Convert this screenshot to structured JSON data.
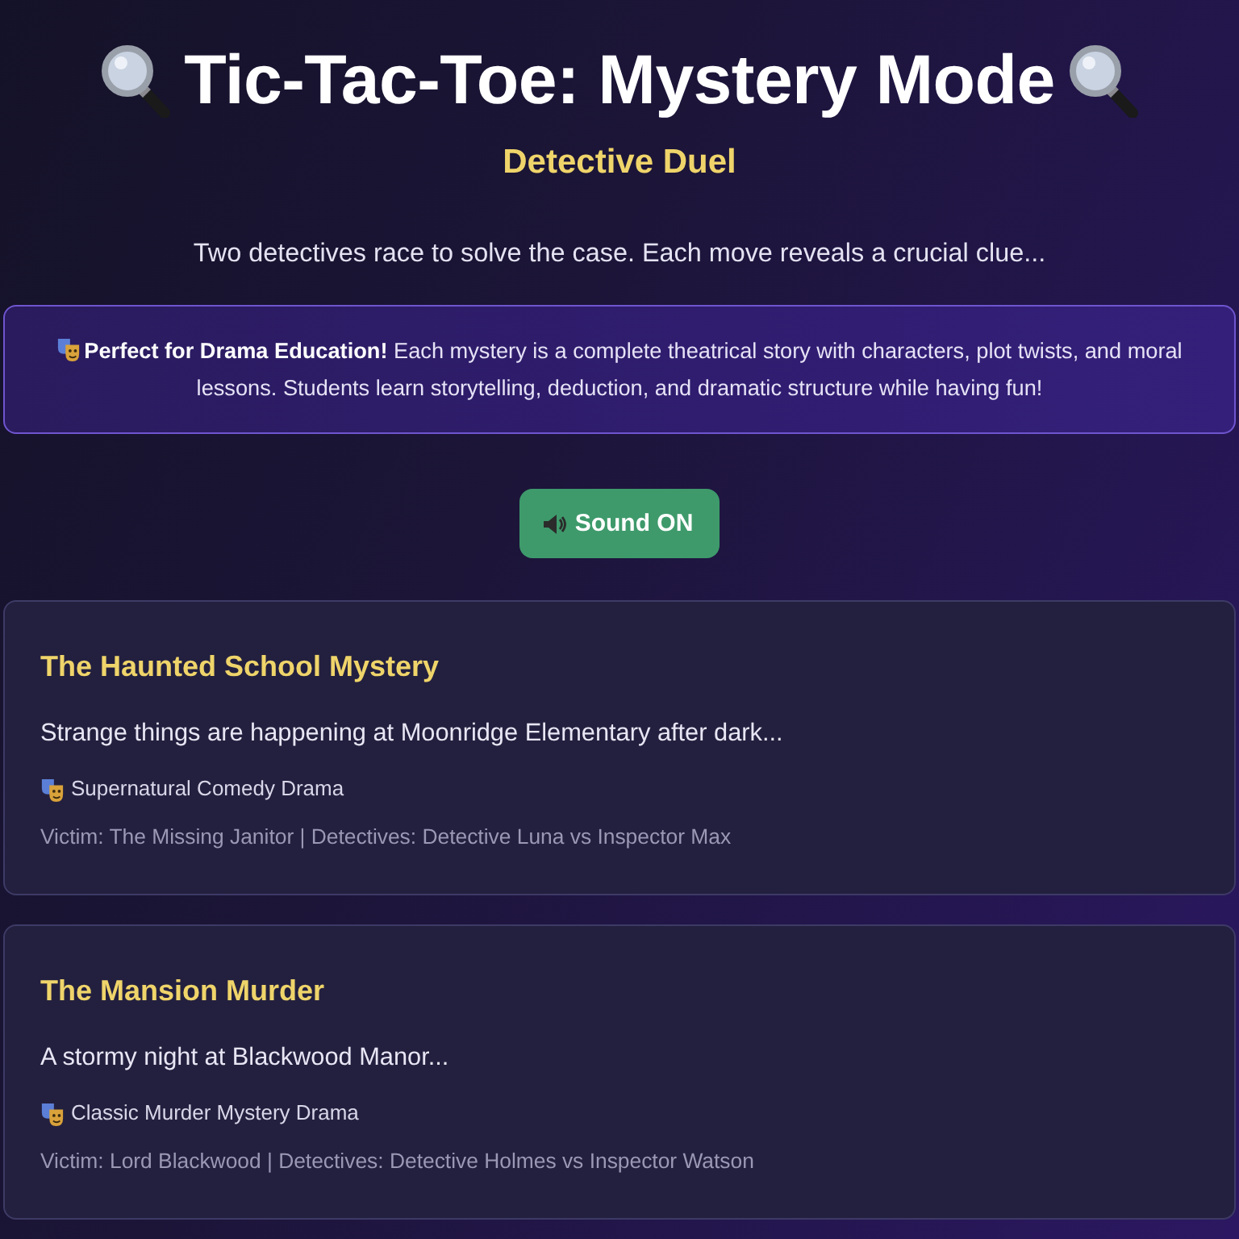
{
  "header": {
    "title": "Tic-Tac-Toe: Mystery Mode",
    "subtitle": "Detective Duel",
    "tagline": "Two detectives race to solve the case. Each move reveals a crucial clue..."
  },
  "info_box": {
    "text": "**Perfect for Drama Education!** Each mystery is a complete theatrical story with characters, plot twists, and moral lessons. Students learn storytelling, deduction, and dramatic structure while having fun!"
  },
  "sound_button": {
    "label": "Sound ON",
    "on": true
  },
  "mysteries": [
    {
      "title": "The Haunted School Mystery",
      "description": "Strange things are happening at Moonridge Elementary after dark...",
      "genre": "Supernatural Comedy Drama",
      "details": "Victim: The Missing Janitor | Detectives: Detective Luna vs Inspector Max"
    },
    {
      "title": "The Mansion Murder",
      "description": "A stormy night at Blackwood Manor...",
      "genre": "Classic Murder Mystery Drama",
      "details": "Victim: Lord Blackwood | Detectives: Detective Holmes vs Inspector Watson"
    }
  ]
}
